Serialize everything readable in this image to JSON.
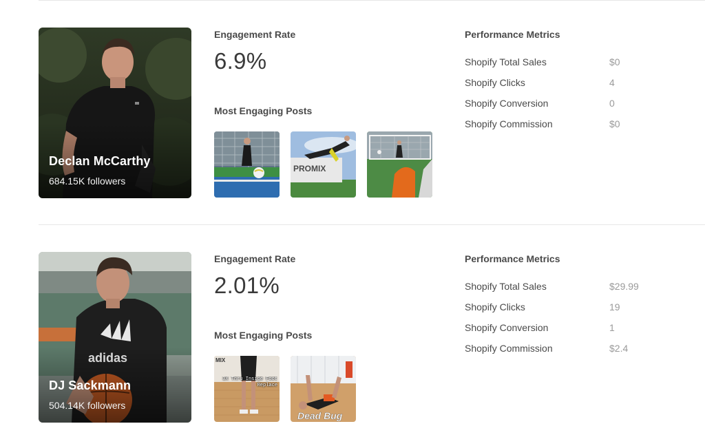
{
  "influencers": [
    {
      "name": "Declan McCarthy",
      "followers": "684.15K followers",
      "engagement_label": "Engagement Rate",
      "engagement_rate": "6.9%",
      "posts_label": "Most Engaging Posts",
      "posts": [
        {
          "image": "goalkeeper-training-photo"
        },
        {
          "image": "promix-diving-save-photo"
        },
        {
          "image": "goal-drill-photo"
        }
      ],
      "performance_title": "Performance Metrics",
      "metrics": [
        {
          "label": "Shopify Total Sales",
          "value": "$0"
        },
        {
          "label": "Shopify Clicks",
          "value": "4"
        },
        {
          "label": "Shopify Conversion",
          "value": "0"
        },
        {
          "label": "Shopify Commission",
          "value": "$0"
        }
      ]
    },
    {
      "name": "DJ Sackmann",
      "followers": "504.14K followers",
      "engagement_label": "Engagement Rate",
      "engagement_rate": "2.01%",
      "posts_label": "Most Engaging Posts",
      "posts": [
        {
          "image": "basketball-footwork-photo",
          "overlay_brand": "MIX",
          "overlay_text": "3X Thru Inside Foot Replace"
        },
        {
          "image": "dead-bug-exercise-photo",
          "overlay_text": "Dead Bug"
        }
      ],
      "performance_title": "Performance Metrics",
      "metrics": [
        {
          "label": "Shopify Total Sales",
          "value": "$29.99"
        },
        {
          "label": "Shopify Clicks",
          "value": "19"
        },
        {
          "label": "Shopify Conversion",
          "value": "1"
        },
        {
          "label": "Shopify Commission",
          "value": "$2.4"
        }
      ]
    }
  ]
}
